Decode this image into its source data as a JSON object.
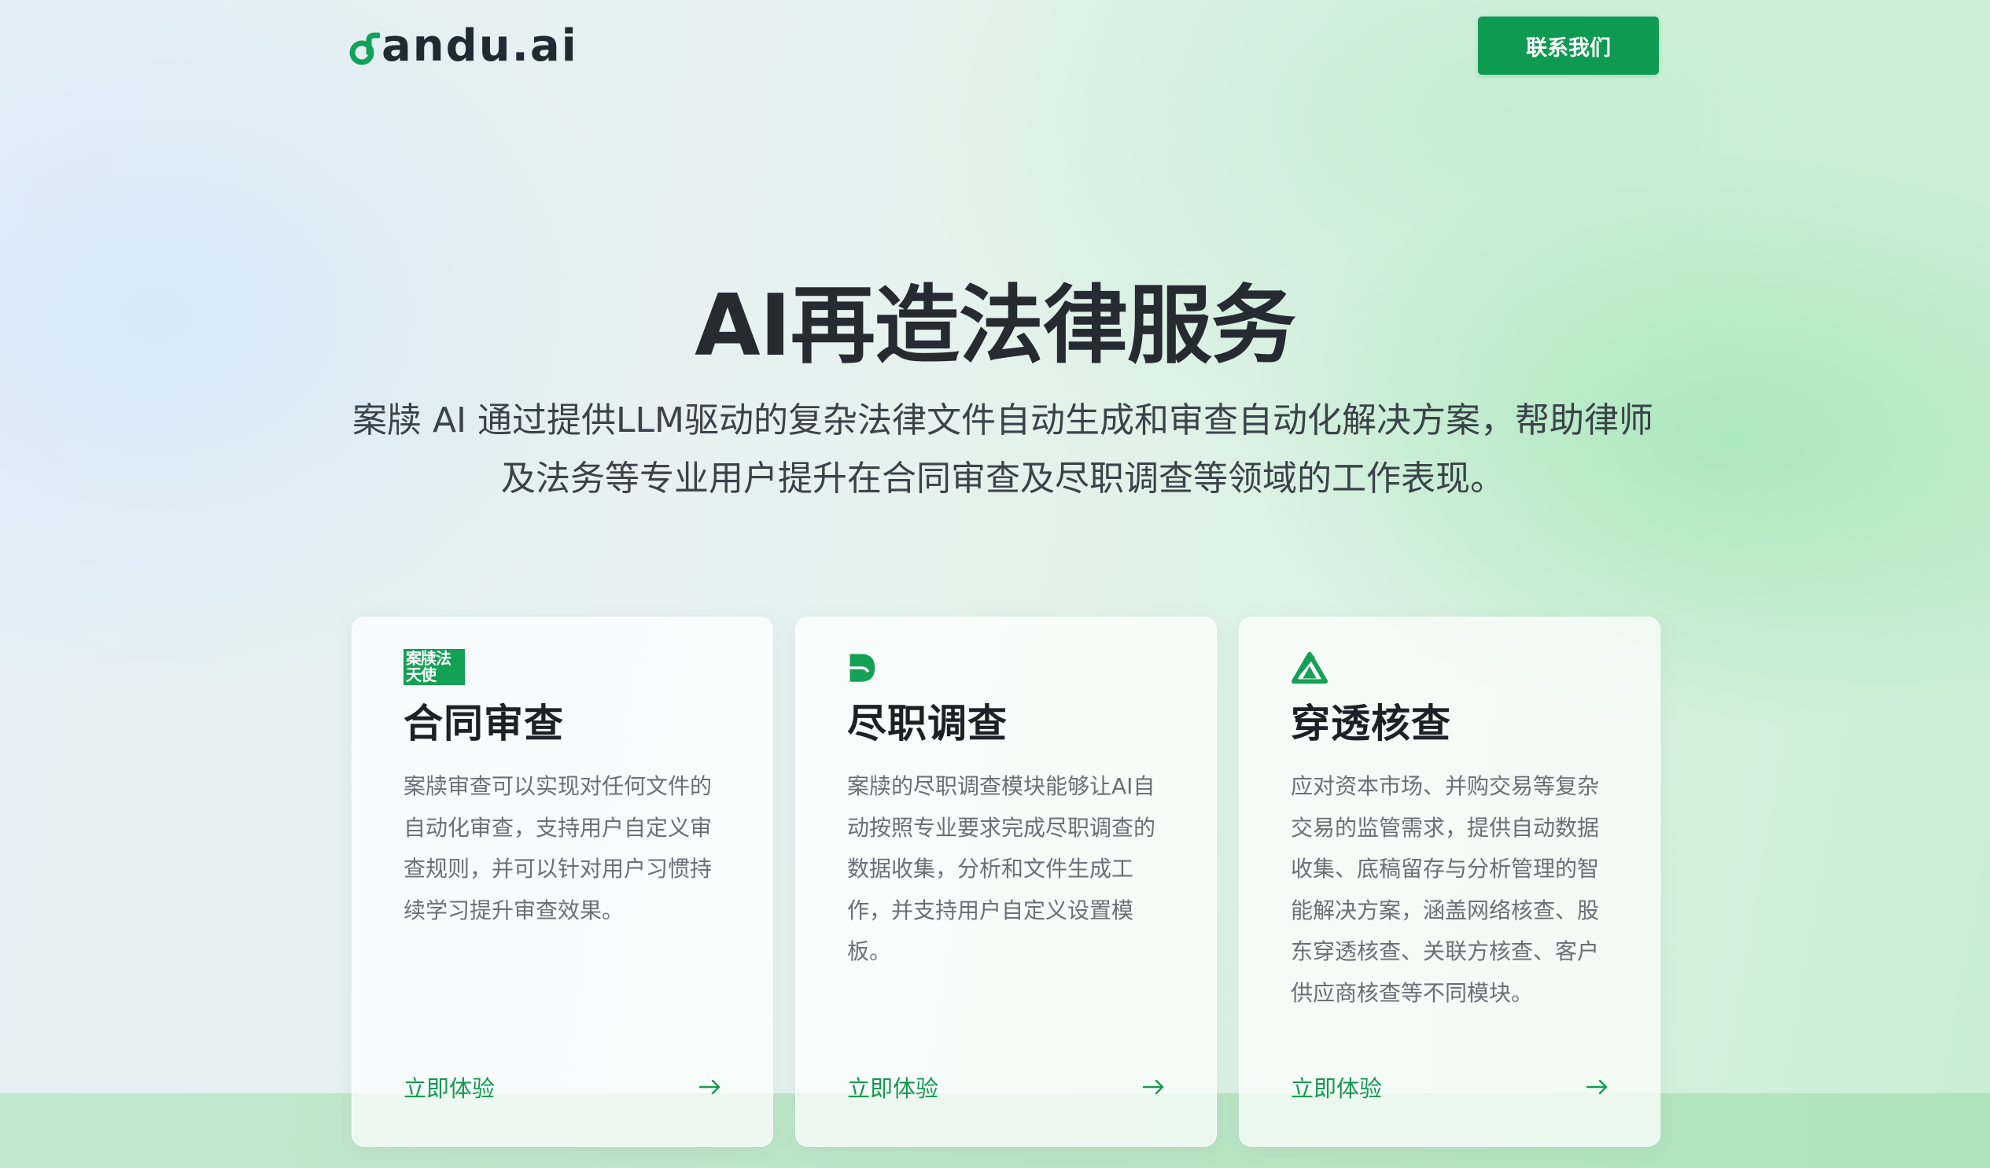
{
  "header": {
    "logo_text": "andu.ai",
    "logo_icon": "dandu-logo-mark",
    "contact_label": "联系我们"
  },
  "hero": {
    "title": "AI再造法律服务",
    "subtitle": "案牍 AI 通过提供LLM驱动的复杂法律文件自动生成和审查自动化解决方案，帮助律师及法务等专业用户提升在合同审查及尽职调查等领域的工作表现。"
  },
  "cards": [
    {
      "icon": "law-angel-seal-icon",
      "icon_text": "案牍法天使",
      "title": "合同审查",
      "description": "案牍审查可以实现对任何文件的自动化审查，支持用户自定义审查规则，并可以针对用户习惯持续学习提升审查效果。",
      "link_label": "立即体验",
      "arrow_icon": "arrow-right-icon"
    },
    {
      "icon": "d-shape-logo-icon",
      "title": "尽职调查",
      "description": "案牍的尽职调查模块能够让AI自动按照专业要求完成尽职调查的数据收集，分析和文件生成工作，并支持用户自定义设置模板。",
      "link_label": "立即体验",
      "arrow_icon": "arrow-right-icon"
    },
    {
      "icon": "triangle-network-icon",
      "title": "穿透核查",
      "description": "应对资本市场、并购交易等复杂交易的监管需求，提供自动数据收集、底稿留存与分析管理的智能解决方案，涵盖网络核查、股东穿透核查、关联方核查、客户供应商核查等不同模块。",
      "link_label": "立即体验",
      "arrow_icon": "arrow-right-icon"
    }
  ],
  "colors": {
    "brand_green": "#0f9a52",
    "link_green": "#139a52",
    "title_dark": "#262b31"
  }
}
